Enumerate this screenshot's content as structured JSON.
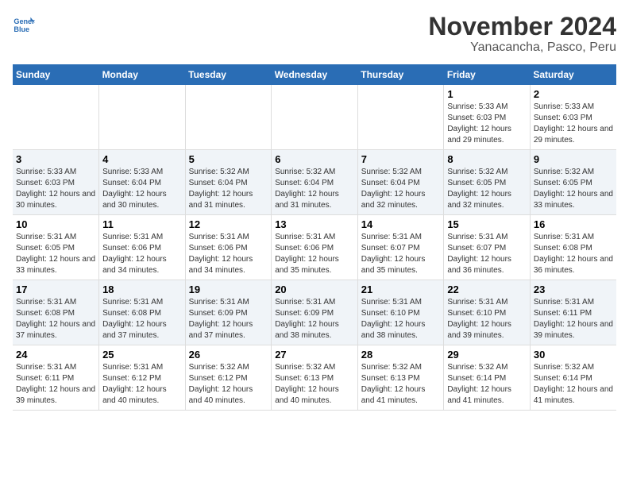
{
  "logo": {
    "line1": "General",
    "line2": "Blue"
  },
  "title": "November 2024",
  "subtitle": "Yanacancha, Pasco, Peru",
  "days_of_week": [
    "Sunday",
    "Monday",
    "Tuesday",
    "Wednesday",
    "Thursday",
    "Friday",
    "Saturday"
  ],
  "weeks": [
    [
      {
        "day": "",
        "info": ""
      },
      {
        "day": "",
        "info": ""
      },
      {
        "day": "",
        "info": ""
      },
      {
        "day": "",
        "info": ""
      },
      {
        "day": "",
        "info": ""
      },
      {
        "day": "1",
        "info": "Sunrise: 5:33 AM\nSunset: 6:03 PM\nDaylight: 12 hours and 29 minutes."
      },
      {
        "day": "2",
        "info": "Sunrise: 5:33 AM\nSunset: 6:03 PM\nDaylight: 12 hours and 29 minutes."
      }
    ],
    [
      {
        "day": "3",
        "info": "Sunrise: 5:33 AM\nSunset: 6:03 PM\nDaylight: 12 hours and 30 minutes."
      },
      {
        "day": "4",
        "info": "Sunrise: 5:33 AM\nSunset: 6:04 PM\nDaylight: 12 hours and 30 minutes."
      },
      {
        "day": "5",
        "info": "Sunrise: 5:32 AM\nSunset: 6:04 PM\nDaylight: 12 hours and 31 minutes."
      },
      {
        "day": "6",
        "info": "Sunrise: 5:32 AM\nSunset: 6:04 PM\nDaylight: 12 hours and 31 minutes."
      },
      {
        "day": "7",
        "info": "Sunrise: 5:32 AM\nSunset: 6:04 PM\nDaylight: 12 hours and 32 minutes."
      },
      {
        "day": "8",
        "info": "Sunrise: 5:32 AM\nSunset: 6:05 PM\nDaylight: 12 hours and 32 minutes."
      },
      {
        "day": "9",
        "info": "Sunrise: 5:32 AM\nSunset: 6:05 PM\nDaylight: 12 hours and 33 minutes."
      }
    ],
    [
      {
        "day": "10",
        "info": "Sunrise: 5:31 AM\nSunset: 6:05 PM\nDaylight: 12 hours and 33 minutes."
      },
      {
        "day": "11",
        "info": "Sunrise: 5:31 AM\nSunset: 6:06 PM\nDaylight: 12 hours and 34 minutes."
      },
      {
        "day": "12",
        "info": "Sunrise: 5:31 AM\nSunset: 6:06 PM\nDaylight: 12 hours and 34 minutes."
      },
      {
        "day": "13",
        "info": "Sunrise: 5:31 AM\nSunset: 6:06 PM\nDaylight: 12 hours and 35 minutes."
      },
      {
        "day": "14",
        "info": "Sunrise: 5:31 AM\nSunset: 6:07 PM\nDaylight: 12 hours and 35 minutes."
      },
      {
        "day": "15",
        "info": "Sunrise: 5:31 AM\nSunset: 6:07 PM\nDaylight: 12 hours and 36 minutes."
      },
      {
        "day": "16",
        "info": "Sunrise: 5:31 AM\nSunset: 6:08 PM\nDaylight: 12 hours and 36 minutes."
      }
    ],
    [
      {
        "day": "17",
        "info": "Sunrise: 5:31 AM\nSunset: 6:08 PM\nDaylight: 12 hours and 37 minutes."
      },
      {
        "day": "18",
        "info": "Sunrise: 5:31 AM\nSunset: 6:08 PM\nDaylight: 12 hours and 37 minutes."
      },
      {
        "day": "19",
        "info": "Sunrise: 5:31 AM\nSunset: 6:09 PM\nDaylight: 12 hours and 37 minutes."
      },
      {
        "day": "20",
        "info": "Sunrise: 5:31 AM\nSunset: 6:09 PM\nDaylight: 12 hours and 38 minutes."
      },
      {
        "day": "21",
        "info": "Sunrise: 5:31 AM\nSunset: 6:10 PM\nDaylight: 12 hours and 38 minutes."
      },
      {
        "day": "22",
        "info": "Sunrise: 5:31 AM\nSunset: 6:10 PM\nDaylight: 12 hours and 39 minutes."
      },
      {
        "day": "23",
        "info": "Sunrise: 5:31 AM\nSunset: 6:11 PM\nDaylight: 12 hours and 39 minutes."
      }
    ],
    [
      {
        "day": "24",
        "info": "Sunrise: 5:31 AM\nSunset: 6:11 PM\nDaylight: 12 hours and 39 minutes."
      },
      {
        "day": "25",
        "info": "Sunrise: 5:31 AM\nSunset: 6:12 PM\nDaylight: 12 hours and 40 minutes."
      },
      {
        "day": "26",
        "info": "Sunrise: 5:32 AM\nSunset: 6:12 PM\nDaylight: 12 hours and 40 minutes."
      },
      {
        "day": "27",
        "info": "Sunrise: 5:32 AM\nSunset: 6:13 PM\nDaylight: 12 hours and 40 minutes."
      },
      {
        "day": "28",
        "info": "Sunrise: 5:32 AM\nSunset: 6:13 PM\nDaylight: 12 hours and 41 minutes."
      },
      {
        "day": "29",
        "info": "Sunrise: 5:32 AM\nSunset: 6:14 PM\nDaylight: 12 hours and 41 minutes."
      },
      {
        "day": "30",
        "info": "Sunrise: 5:32 AM\nSunset: 6:14 PM\nDaylight: 12 hours and 41 minutes."
      }
    ]
  ]
}
